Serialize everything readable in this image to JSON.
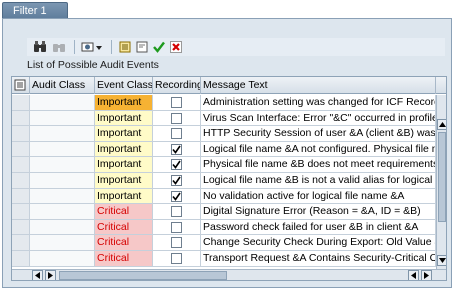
{
  "tab": {
    "label": "Filter 1"
  },
  "list_title": "List of Possible Audit Events",
  "columns": [
    "Audit Class",
    "Event Class",
    "Recording",
    "Message Text"
  ],
  "rows": [
    {
      "audit_class": "",
      "event_class": "Important",
      "recording": false,
      "message": "Administration setting was changed for ICF Record"
    },
    {
      "audit_class": "",
      "event_class": "Important",
      "recording": false,
      "message": "Virus Scan Interface: Error \"&C\" occurred in profile &"
    },
    {
      "audit_class": "",
      "event_class": "Important",
      "recording": false,
      "message": "HTTP Security Session of user &A (client &B) was h"
    },
    {
      "audit_class": "",
      "event_class": "Important",
      "recording": true,
      "message": "Logical file name &A not configured. Physical file na"
    },
    {
      "audit_class": "",
      "event_class": "Important",
      "recording": true,
      "message": "Physical file name &B does not meet requirements"
    },
    {
      "audit_class": "",
      "event_class": "Important",
      "recording": true,
      "message": "Logical file name &B is not a valid alias for logical fi"
    },
    {
      "audit_class": "",
      "event_class": "Important",
      "recording": true,
      "message": "No validation active for logical file name &A"
    },
    {
      "audit_class": "",
      "event_class": "Critical",
      "recording": false,
      "message": "Digital Signature Error (Reason = &A, ID = &B)"
    },
    {
      "audit_class": "",
      "event_class": "Critical",
      "recording": false,
      "message": "Password check failed for user &B in client &A"
    },
    {
      "audit_class": "",
      "event_class": "Critical",
      "recording": false,
      "message": "Change Security Check During Export: Old Value &A"
    },
    {
      "audit_class": "",
      "event_class": "Critical",
      "recording": false,
      "message": "Transport Request &A Contains Security-Critical Ob"
    }
  ],
  "colors": {
    "important": "#fffbc8",
    "important_selected": "#f6b233",
    "critical": "#f6c8c8",
    "critical_text": "#d50000",
    "tab": "#6b88a6"
  },
  "toolbar_icons": [
    "binoculars-icon",
    "find-next-icon",
    "settings-dropdown-icon",
    "select-all-icon",
    "deselect-all-icon",
    "confirm-icon",
    "cancel-icon"
  ]
}
